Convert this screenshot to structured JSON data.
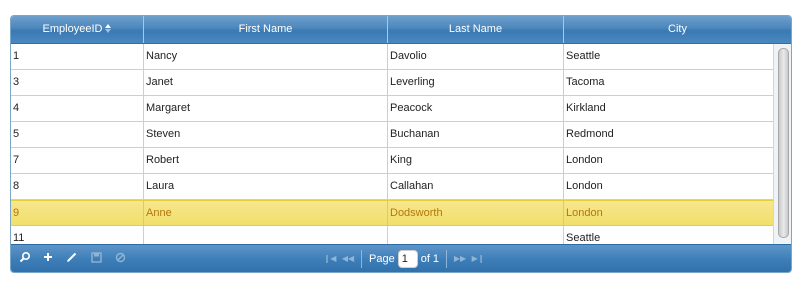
{
  "columns": [
    {
      "label": "EmployeeID",
      "sorted": "ascending"
    },
    {
      "label": "First Name"
    },
    {
      "label": "Last Name"
    },
    {
      "label": "City"
    }
  ],
  "rows": [
    [
      "1",
      "Nancy",
      "Davolio",
      "Seattle"
    ],
    [
      "3",
      "Janet",
      "Leverling",
      "Tacoma"
    ],
    [
      "4",
      "Margaret",
      "Peacock",
      "Kirkland"
    ],
    [
      "5",
      "Steven",
      "Buchanan",
      "Redmond"
    ],
    [
      "7",
      "Robert",
      "King",
      "London"
    ],
    [
      "8",
      "Laura",
      "Callahan",
      "London"
    ],
    [
      "9",
      "Anne",
      "Dodsworth",
      "London"
    ],
    [
      "11",
      "",
      "",
      "Seattle"
    ]
  ],
  "selected_row_index": 6,
  "pager": {
    "page_label": "Page",
    "current_page": "1",
    "of_label": "of 1"
  },
  "toolbar": {
    "icons": [
      "search-icon",
      "add-icon",
      "edit-icon",
      "save-icon",
      "cancel-icon"
    ]
  },
  "colors": {
    "header": "#4b86bc",
    "selected_row": "#f3e27a",
    "selected_text": "#b5760f"
  }
}
